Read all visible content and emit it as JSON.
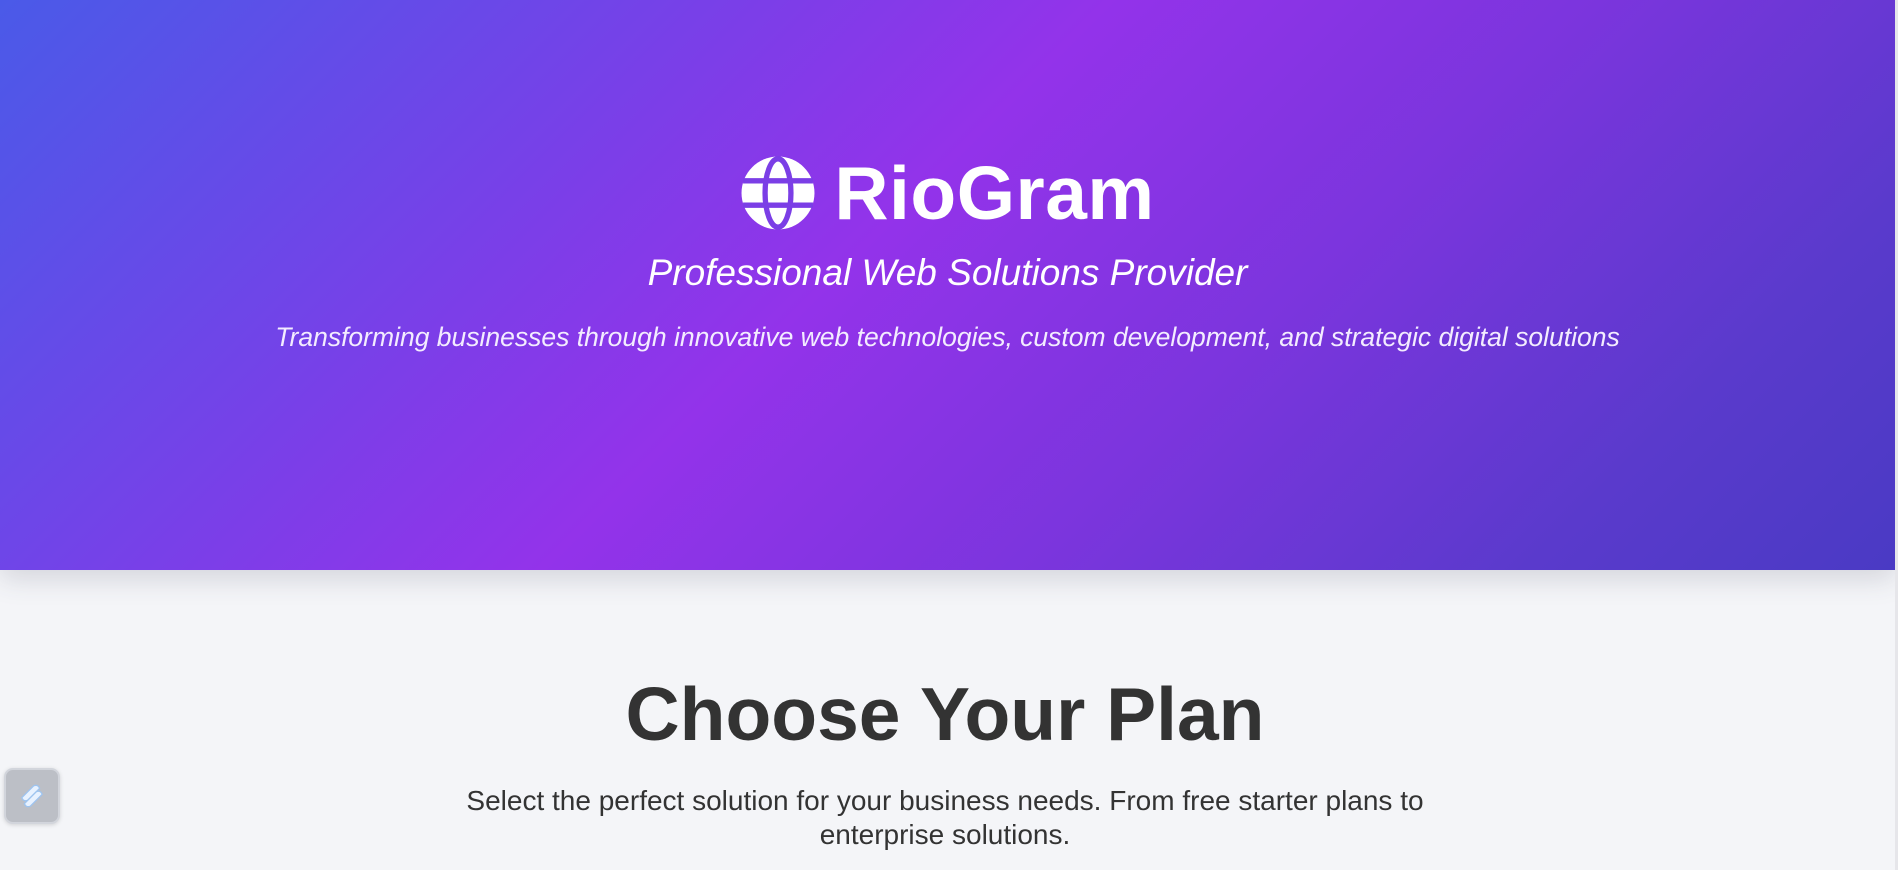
{
  "hero": {
    "brand_name": "RioGram",
    "logo_icon": "globe-icon",
    "tagline": "Professional Web Solutions Provider",
    "description": "Transforming businesses through innovative web technologies, custom development, and strategic digital solutions"
  },
  "plans": {
    "title": "Choose Your Plan",
    "subtitle": "Select the perfect solution for your business needs. From free starter plans to enterprise solutions."
  },
  "widget": {
    "icon": "widget-logo-icon"
  },
  "colors": {
    "hero_gradient_start": "#4a5ae8",
    "hero_gradient_mid": "#9333ea",
    "hero_gradient_end": "#4a3ac4",
    "page_background": "#f4f5f8",
    "heading_text": "#333333"
  }
}
